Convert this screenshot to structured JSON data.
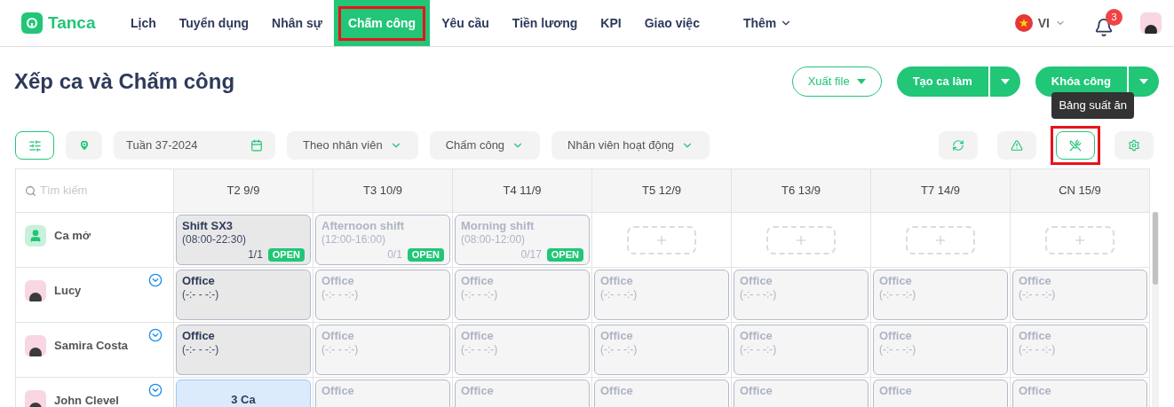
{
  "logo": {
    "text": "Tanca"
  },
  "nav": [
    {
      "label": "Lịch",
      "selected": false,
      "highlighted": false
    },
    {
      "label": "Tuyển dụng",
      "selected": false,
      "highlighted": false
    },
    {
      "label": "Nhân sự",
      "selected": false,
      "highlighted": false
    },
    {
      "label": "Chấm công",
      "selected": true,
      "highlighted": true
    },
    {
      "label": "Yêu cầu",
      "selected": false,
      "highlighted": false
    },
    {
      "label": "Tiền lương",
      "selected": false,
      "highlighted": false
    },
    {
      "label": "KPI",
      "selected": false,
      "highlighted": false
    },
    {
      "label": "Giao việc",
      "selected": false,
      "highlighted": false
    }
  ],
  "more_menu": {
    "label": "Thêm"
  },
  "language": {
    "label": "VI"
  },
  "notifications": {
    "count": "3"
  },
  "page_title": "Xếp ca và Chấm công",
  "actions": [
    {
      "label": "Xuất file",
      "kind": "outline"
    },
    {
      "label": "Tạo ca làm",
      "kind": "split"
    },
    {
      "label": "Khóa công",
      "kind": "split"
    }
  ],
  "tooltip": "Bảng suất ăn",
  "filters": {
    "week": "Tuần 37-2024",
    "dropdowns": [
      "Theo nhân viên",
      "Chấm công",
      "Nhân viên hoạt động"
    ]
  },
  "tools": [
    {
      "kind": "refresh",
      "highlighted": false
    },
    {
      "kind": "warning",
      "highlighted": false
    },
    {
      "kind": "meal",
      "highlighted": true
    },
    {
      "kind": "settings",
      "highlighted": false
    }
  ],
  "table": {
    "search": {
      "placeholder": "Tìm kiếm"
    },
    "columns": [
      "T2 9/9",
      "T3 10/9",
      "T4 11/9",
      "T5 12/9",
      "T6 13/9",
      "T7 14/9",
      "CN 15/9"
    ],
    "rows": [
      {
        "name": "Ca mở",
        "kind": "open",
        "expandable": false,
        "cells": [
          {
            "kind": "shift",
            "active": true,
            "title": "Shift SX3",
            "time": "(08:00-22:30)",
            "count": "1/1",
            "badge": "OPEN"
          },
          {
            "kind": "shift",
            "active": false,
            "title": "Afternoon shift",
            "time": "(12:00-16:00)",
            "count": "0/1",
            "badge": "OPEN"
          },
          {
            "kind": "shift",
            "active": false,
            "title": "Morning shift",
            "time": "(08:00-12:00)",
            "count": "0/17",
            "badge": "OPEN"
          },
          {
            "kind": "add"
          },
          {
            "kind": "add"
          },
          {
            "kind": "add"
          },
          {
            "kind": "add"
          }
        ]
      },
      {
        "name": "Lucy",
        "kind": "person",
        "expandable": true,
        "cells": [
          {
            "kind": "shift",
            "active": true,
            "title": "Office",
            "time": "(-:- - -:-)"
          },
          {
            "kind": "shift",
            "active": false,
            "title": "Office",
            "time": "(-:- - -:-)"
          },
          {
            "kind": "shift",
            "active": false,
            "title": "Office",
            "time": "(-:- - -:-)"
          },
          {
            "kind": "shift",
            "active": false,
            "title": "Office",
            "time": "(-:- - -:-)"
          },
          {
            "kind": "shift",
            "active": false,
            "title": "Office",
            "time": "(-:- - -:-)"
          },
          {
            "kind": "shift",
            "active": false,
            "title": "Office",
            "time": "(-:- - -:-)"
          },
          {
            "kind": "shift",
            "active": false,
            "title": "Office",
            "time": "(-:- - -:-)"
          }
        ]
      },
      {
        "name": "Samira Costa",
        "kind": "person",
        "expandable": true,
        "cells": [
          {
            "kind": "shift",
            "active": true,
            "title": "Office",
            "time": "(-:- - -:-)"
          },
          {
            "kind": "shift",
            "active": false,
            "title": "Office",
            "time": "(-:- - -:-)"
          },
          {
            "kind": "shift",
            "active": false,
            "title": "Office",
            "time": "(-:- - -:-)"
          },
          {
            "kind": "shift",
            "active": false,
            "title": "Office",
            "time": "(-:- - -:-)"
          },
          {
            "kind": "shift",
            "active": false,
            "title": "Office",
            "time": "(-:- - -:-)"
          },
          {
            "kind": "shift",
            "active": false,
            "title": "Office",
            "time": "(-:- - -:-)"
          },
          {
            "kind": "shift",
            "active": false,
            "title": "Office",
            "time": "(-:- - -:-)"
          }
        ]
      },
      {
        "name": "John Clevel",
        "kind": "person",
        "expandable": true,
        "cells": [
          {
            "kind": "multi",
            "title": "3 Ca"
          },
          {
            "kind": "shift",
            "active": false,
            "title": "Office"
          },
          {
            "kind": "shift",
            "active": false,
            "title": "Office"
          },
          {
            "kind": "shift",
            "active": false,
            "title": "Office"
          },
          {
            "kind": "shift",
            "active": false,
            "title": "Office"
          },
          {
            "kind": "shift",
            "active": false,
            "title": "Office"
          },
          {
            "kind": "shift",
            "active": false,
            "title": "Office"
          }
        ]
      }
    ]
  }
}
